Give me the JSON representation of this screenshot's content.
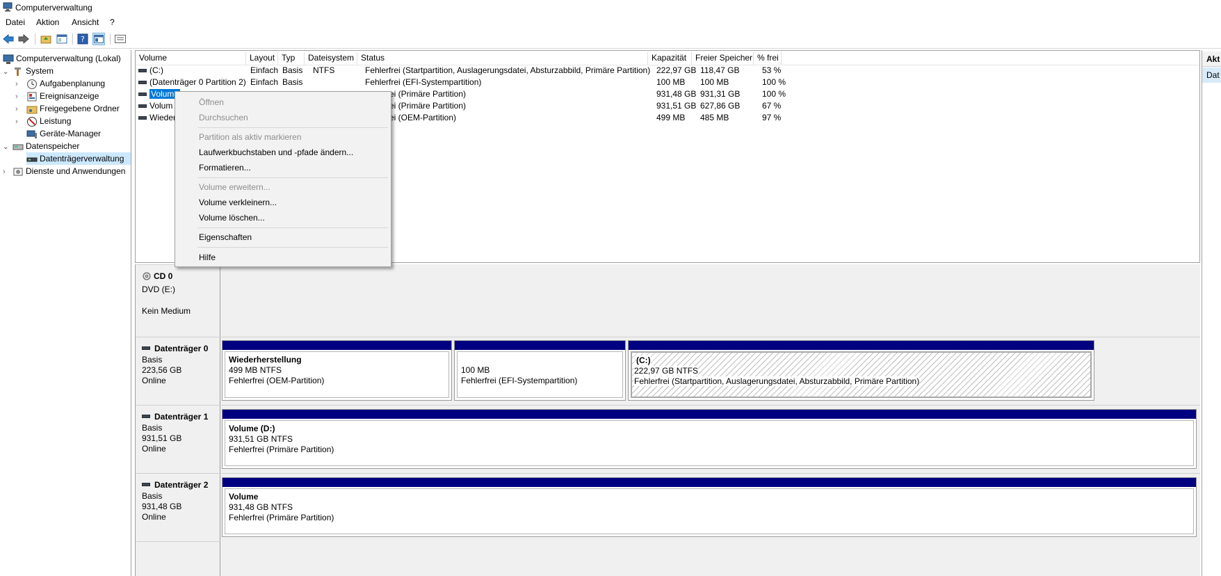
{
  "window": {
    "title": "Computerverwaltung"
  },
  "menu": [
    "Datei",
    "Aktion",
    "Ansicht",
    "?"
  ],
  "toolbar": {
    "icons": [
      "back-arrow-icon",
      "forward-arrow-icon",
      "up-folder-icon",
      "show-hide-tree-icon",
      "help-icon",
      "console-view-icon",
      "properties-icon"
    ]
  },
  "tree": {
    "root": "Computerverwaltung (Lokal)",
    "system": "System",
    "aufgabenplanung": "Aufgabenplanung",
    "ereignisanzeige": "Ereignisanzeige",
    "freigegebene": "Freigegebene Ordner",
    "leistung": "Leistung",
    "geraete": "Geräte-Manager",
    "datenspeicher": "Datenspeicher",
    "datentraeger": "Datenträgerverwaltung",
    "dienste": "Dienste und Anwendungen"
  },
  "columns": [
    "Volume",
    "Layout",
    "Typ",
    "Dateisystem",
    "Status",
    "Kapazität",
    "Freier Speicher",
    "% frei"
  ],
  "volumes": [
    {
      "volume": "(C:)",
      "layout": "Einfach",
      "typ": "Basis",
      "fs": "NTFS",
      "status": "Fehlerfrei (Startpartition, Auslagerungsdatei, Absturzabbild, Primäre Partition)",
      "kap": "222,97 GB",
      "frei": "118,47 GB",
      "pct": "53 %"
    },
    {
      "volume": "(Datenträger 0 Partition 2)",
      "layout": "Einfach",
      "typ": "Basis",
      "fs": "",
      "status": "Fehlerfrei (EFI-Systempartition)",
      "kap": "100 MB",
      "frei": "100 MB",
      "pct": "100 %"
    },
    {
      "volume": "Volume",
      "layout": "",
      "typ": "",
      "fs": "",
      "status": "rei (Primäre Partition)",
      "kap": "931,48 GB",
      "frei": "931,31 GB",
      "pct": "100 %"
    },
    {
      "volume": "Volum",
      "layout": "",
      "typ": "",
      "fs": "",
      "status": "rei (Primäre Partition)",
      "kap": "931,51 GB",
      "frei": "627,86 GB",
      "pct": "67 %"
    },
    {
      "volume": "Wieder",
      "layout": "",
      "typ": "",
      "fs": "",
      "status": "rei (OEM-Partition)",
      "kap": "499 MB",
      "frei": "485 MB",
      "pct": "97 %"
    }
  ],
  "context_menu": {
    "oeffnen": "Öffnen",
    "durchsuchen": "Durchsuchen",
    "aktiv": "Partition als aktiv markieren",
    "laufwerk": "Laufwerkbuchstaben und -pfade ändern...",
    "formatieren": "Formatieren...",
    "erweitern": "Volume erweitern...",
    "verkleinern": "Volume verkleinern...",
    "loeschen": "Volume löschen...",
    "eigenschaften": "Eigenschaften",
    "hilfe": "Hilfe"
  },
  "disks": {
    "cd0": {
      "name": "CD 0",
      "line1": "DVD (E:)",
      "line3": "Kein Medium"
    },
    "d0": {
      "name": "Datenträger 0",
      "typ": "Basis",
      "size": "223,56 GB",
      "state": "Online",
      "parts": [
        {
          "title": "Wiederherstellung",
          "size": "499 MB NTFS",
          "status": "Fehlerfrei (OEM-Partition)"
        },
        {
          "size": "100 MB",
          "status": "Fehlerfrei (EFI-Systempartition)"
        },
        {
          "title": "(C:)",
          "size": "222,97 GB NTFS",
          "status": "Fehlerfrei (Startpartition, Auslagerungsdatei, Absturzabbild, Primäre Partition)"
        }
      ]
    },
    "d1": {
      "name": "Datenträger 1",
      "typ": "Basis",
      "size": "931,51 GB",
      "state": "Online",
      "part": {
        "title": "Volume  (D:)",
        "size": "931,51 GB NTFS",
        "status": "Fehlerfrei (Primäre Partition)"
      }
    },
    "d2": {
      "name": "Datenträger 2",
      "typ": "Basis",
      "size": "931,48 GB",
      "state": "Online",
      "part": {
        "title": "Volume",
        "size": "931,48 GB NTFS",
        "status": "Fehlerfrei (Primäre Partition)"
      }
    }
  },
  "actions": {
    "header": "Akt",
    "item": "Dat"
  },
  "colors": {
    "partition_bar": "#000080",
    "selection": "#0078d7",
    "tree_selection": "#cce8ff"
  }
}
